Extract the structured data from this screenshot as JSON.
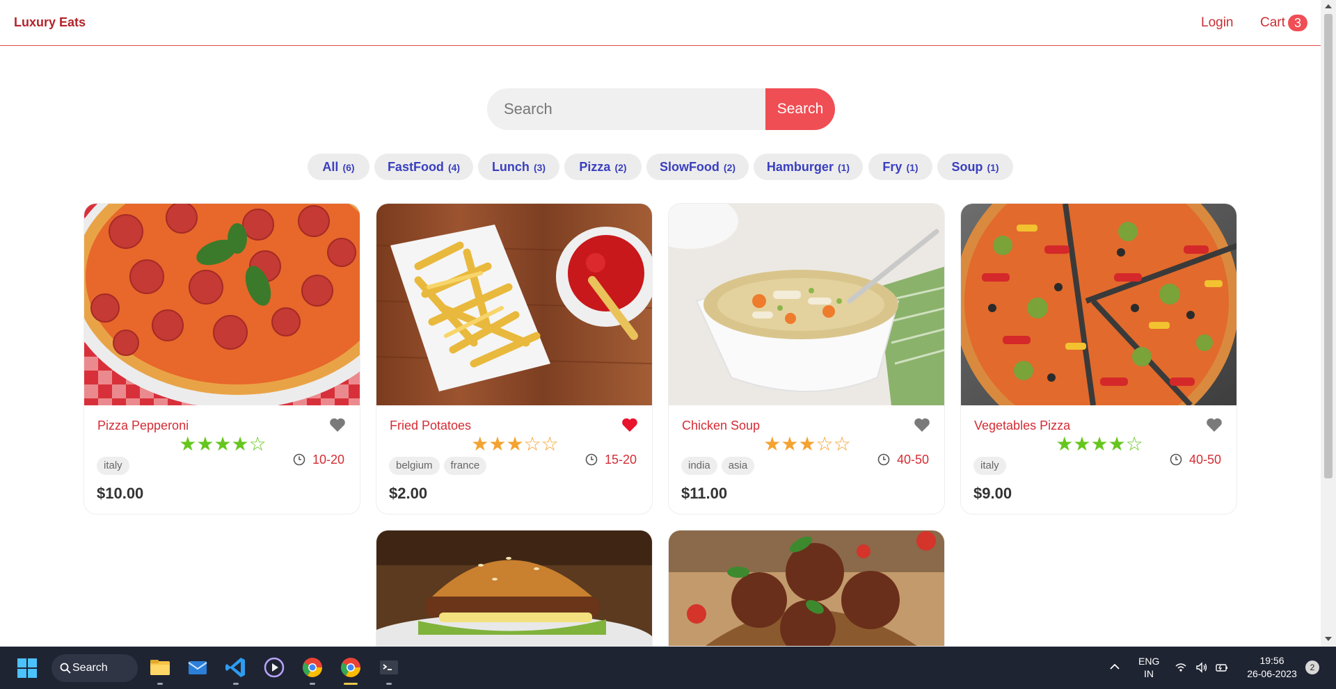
{
  "header": {
    "brand": "Luxury Eats",
    "login_label": "Login",
    "cart_label": "Cart",
    "cart_count": "3"
  },
  "search": {
    "placeholder": "Search",
    "button_label": "Search"
  },
  "tags": [
    {
      "name": "All",
      "count": "(6)"
    },
    {
      "name": "FastFood",
      "count": "(4)"
    },
    {
      "name": "Lunch",
      "count": "(3)"
    },
    {
      "name": "Pizza",
      "count": "(2)"
    },
    {
      "name": "SlowFood",
      "count": "(2)"
    },
    {
      "name": "Hamburger",
      "count": "(1)"
    },
    {
      "name": "Fry",
      "count": "(1)"
    },
    {
      "name": "Soup",
      "count": "(1)"
    }
  ],
  "foods": [
    {
      "name": "Pizza Pepperoni",
      "stars": "★★★★☆",
      "rating": 4,
      "star_color": "green",
      "favorite": false,
      "origins": [
        "italy"
      ],
      "cook_time": "10-20",
      "price": "$10.00"
    },
    {
      "name": "Fried Potatoes",
      "stars": "★★★☆☆",
      "rating": 3,
      "star_color": "orange",
      "favorite": true,
      "origins": [
        "belgium",
        "france"
      ],
      "cook_time": "15-20",
      "price": "$2.00"
    },
    {
      "name": "Chicken Soup",
      "stars": "★★★☆☆",
      "rating": 3,
      "star_color": "orange",
      "favorite": false,
      "origins": [
        "india",
        "asia"
      ],
      "cook_time": "40-50",
      "price": "$11.00"
    },
    {
      "name": "Vegetables Pizza",
      "stars": "★★★★☆",
      "rating": 4,
      "star_color": "green",
      "favorite": false,
      "origins": [
        "italy"
      ],
      "cook_time": "40-50",
      "price": "$9.00"
    }
  ],
  "taskbar": {
    "search_label": "Search",
    "lang_line1": "ENG",
    "lang_line2": "IN",
    "time": "19:56",
    "date": "26-06-2023",
    "notification_count": "2"
  },
  "colors": {
    "accent": "#ef4e54",
    "brand": "#b3242a",
    "tag_text": "#3a3fbf",
    "star_green": "#65c61e",
    "star_orange": "#f4a230",
    "favorite_active": "#e8132c",
    "favorite_inactive": "#7a7a7a"
  }
}
